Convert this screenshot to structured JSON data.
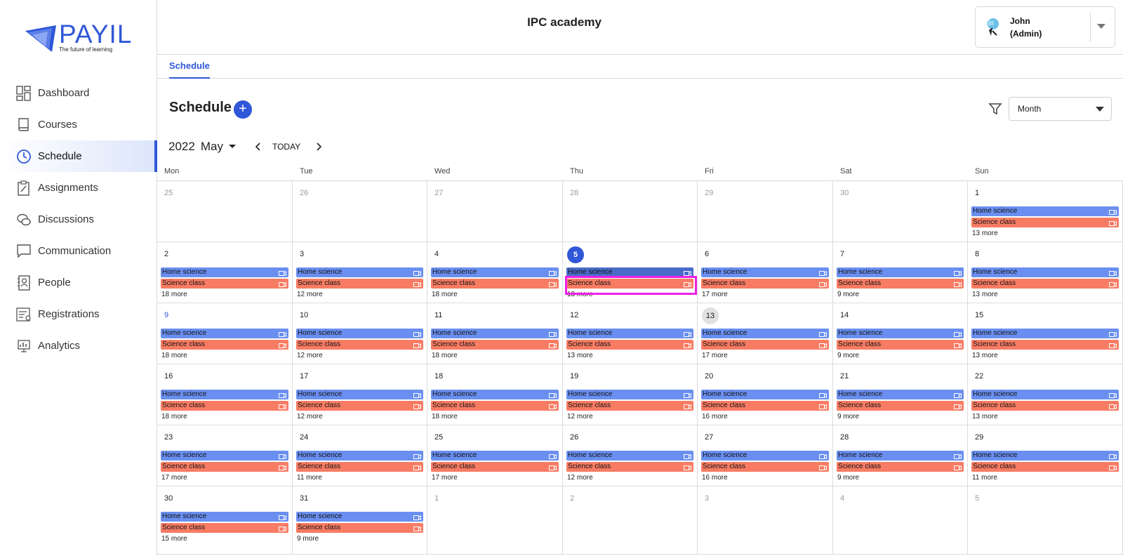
{
  "brand": {
    "name": "PAYIL",
    "tagline": "The future of learning"
  },
  "colors": {
    "accent": "#2f57d8",
    "home_event": "#6a8ff0",
    "science_event": "#f87c64",
    "highlight": "#ee1fe5"
  },
  "sidebar": {
    "items": [
      {
        "label": "Dashboard",
        "icon": "dashboard-icon",
        "active": false
      },
      {
        "label": "Courses",
        "icon": "book-icon",
        "active": false
      },
      {
        "label": "Schedule",
        "icon": "clock-icon",
        "active": true
      },
      {
        "label": "Assignments",
        "icon": "clipboard-icon",
        "active": false
      },
      {
        "label": "Discussions",
        "icon": "chat-bubbles-icon",
        "active": false
      },
      {
        "label": "Communication",
        "icon": "message-icon",
        "active": false
      },
      {
        "label": "People",
        "icon": "contact-book-icon",
        "active": false
      },
      {
        "label": "Registrations",
        "icon": "registration-icon",
        "active": false
      },
      {
        "label": "Analytics",
        "icon": "analytics-icon",
        "active": false
      }
    ]
  },
  "header": {
    "title": "IPC academy",
    "user": {
      "name": "John",
      "role": "(Admin)"
    }
  },
  "tabs": [
    {
      "label": "Schedule",
      "active": true
    }
  ],
  "page": {
    "title": "Schedule",
    "add_label": "+",
    "view": "Month"
  },
  "datebar": {
    "year": "2022",
    "month": "May",
    "today_label": "TODAY"
  },
  "calendar": {
    "weekdays": [
      "Mon",
      "Tue",
      "Wed",
      "Thu",
      "Fri",
      "Sat",
      "Sun"
    ],
    "weeks": [
      [
        {
          "d": "25",
          "o": true
        },
        {
          "d": "26",
          "o": true
        },
        {
          "d": "27",
          "o": true
        },
        {
          "d": "28",
          "o": true
        },
        {
          "d": "29",
          "o": true
        },
        {
          "d": "30",
          "o": true
        },
        {
          "d": "1",
          "ev": true,
          "more": "13 more"
        }
      ],
      [
        {
          "d": "2",
          "ev": true,
          "more": "18 more"
        },
        {
          "d": "3",
          "ev": true,
          "more": "12 more"
        },
        {
          "d": "4",
          "ev": true,
          "more": "18 more"
        },
        {
          "d": "5",
          "ev": true,
          "more": "13 more",
          "today": true
        },
        {
          "d": "6",
          "ev": true,
          "more": "17 more"
        },
        {
          "d": "7",
          "ev": true,
          "more": "9 more"
        },
        {
          "d": "8",
          "ev": true,
          "more": "13 more"
        }
      ],
      [
        {
          "d": "9",
          "ev": true,
          "more": "18 more",
          "blue": true
        },
        {
          "d": "10",
          "ev": true,
          "more": "12 more"
        },
        {
          "d": "11",
          "ev": true,
          "more": "18 more"
        },
        {
          "d": "12",
          "ev": true,
          "more": "13 more"
        },
        {
          "d": "13",
          "ev": true,
          "more": "17 more",
          "sel": true
        },
        {
          "d": "14",
          "ev": true,
          "more": "9 more"
        },
        {
          "d": "15",
          "ev": true,
          "more": "13 more"
        }
      ],
      [
        {
          "d": "16",
          "ev": true,
          "more": "18 more"
        },
        {
          "d": "17",
          "ev": true,
          "more": "12 more"
        },
        {
          "d": "18",
          "ev": true,
          "more": "18 more"
        },
        {
          "d": "19",
          "ev": true,
          "more": "12 more"
        },
        {
          "d": "20",
          "ev": true,
          "more": "16 more"
        },
        {
          "d": "21",
          "ev": true,
          "more": "9 more"
        },
        {
          "d": "22",
          "ev": true,
          "more": "13 more"
        }
      ],
      [
        {
          "d": "23",
          "ev": true,
          "more": "17 more"
        },
        {
          "d": "24",
          "ev": true,
          "more": "11 more"
        },
        {
          "d": "25",
          "ev": true,
          "more": "17 more"
        },
        {
          "d": "26",
          "ev": true,
          "more": "12 more"
        },
        {
          "d": "27",
          "ev": true,
          "more": "16 more"
        },
        {
          "d": "28",
          "ev": true,
          "more": "9 more"
        },
        {
          "d": "29",
          "ev": true,
          "more": "11 more"
        }
      ],
      [
        {
          "d": "30",
          "ev": true,
          "more": "15 more"
        },
        {
          "d": "31",
          "ev": true,
          "more": "9 more"
        },
        {
          "d": "1",
          "o": true
        },
        {
          "d": "2",
          "o": true
        },
        {
          "d": "3",
          "o": true
        },
        {
          "d": "4",
          "o": true
        },
        {
          "d": "5",
          "o": true
        }
      ]
    ],
    "event_home": "Home science",
    "event_science": "Science class"
  }
}
